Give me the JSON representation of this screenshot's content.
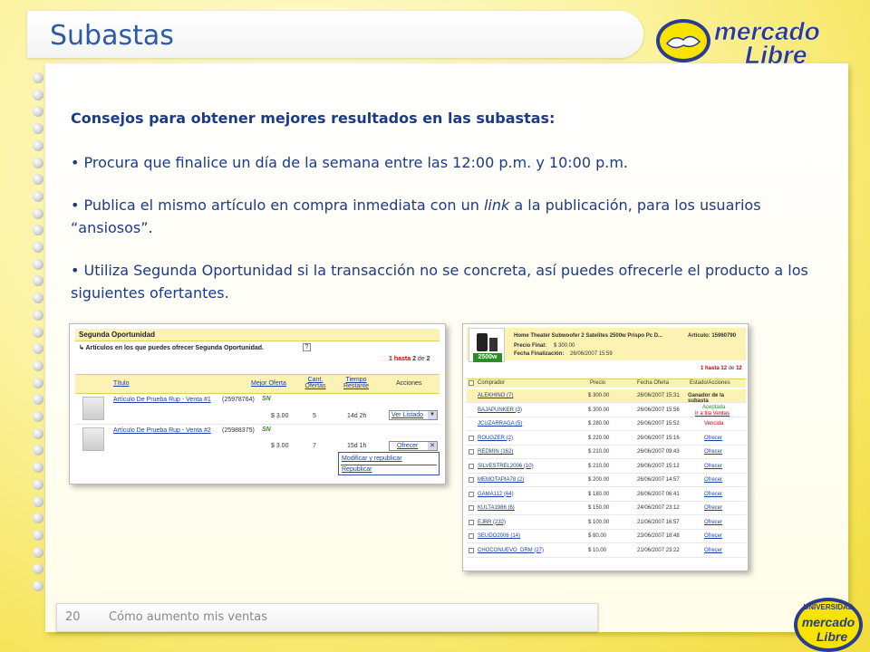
{
  "slide": {
    "title": "Subastas",
    "heading": "Consejos para obtener mejores resultados en las subastas:",
    "bullet1": "• Procura que finalice un día de la semana entre las 12:00 p.m. y 10:00 p.m.",
    "bullet2_pre": "• Publica el mismo artículo en compra inmediata con un ",
    "bullet2_link": "link",
    "bullet2_post": " a la publicación, para los usuarios “ansiosos”.",
    "bullet3": "• Utiliza Segunda Oportunidad si la transacción no se concreta, así puedes ofrecerle el producto a los siguientes ofertantes.",
    "page_number": "20",
    "footer_text": "Cómo aumento mis ventas"
  },
  "logo": {
    "word1": "mercado",
    "word2": "Libre",
    "colors": {
      "blue": "#2a3c8f",
      "yellow": "#f7e200"
    }
  },
  "badge": {
    "top_text": "UNIVERSIDAD",
    "word1": "mercado",
    "word2": "Libre"
  },
  "screenshot1": {
    "title": "Segunda Oportunidad",
    "subtitle": "↳ Artículos en los que puedes ofrecer Segunda Oportunidad.",
    "help": "?",
    "pagination": {
      "prefix": "1 hasta ",
      "current": "2",
      "of": " de ",
      "total": "2"
    },
    "columns": [
      "Título",
      "Mejor Oferta",
      "Cant. Ofertas",
      "Tiempo Restante",
      "Acciones"
    ],
    "rows": [
      {
        "title": "Artículo De Prueba Rup - Venta #1",
        "id": "(25978764)",
        "tag": "SN",
        "price": "$ 3.00",
        "offers": "5",
        "time": "14d 2h",
        "action": "Ver Listado"
      },
      {
        "title": "Artículo De Prueba Rup - Venta #2",
        "id": "(25988375)",
        "tag": "SN",
        "price": "$ 3.00",
        "offers": "7",
        "time": "15d 1h",
        "action": "Ofrecer"
      }
    ],
    "menu": [
      "Modificar y republicar",
      "Republicar"
    ]
  },
  "screenshot2": {
    "product_title": "Home Theater Subwoofer 2 Satelites 2500w Prispo Pc D...",
    "article_label": "Artículo: 15960790",
    "final_price_label": "Precio Final:",
    "final_price": "$ 300.00",
    "end_date_label": "Fecha Finalización:",
    "end_date": "26/06/2007 15:59",
    "product_badge": "2500w",
    "pagination": {
      "prefix": "1 hasta ",
      "current": "12",
      "of": " de ",
      "total": "12"
    },
    "columns": [
      "Comprador",
      "Precio",
      "Fecha Oferta",
      "Estado/Acciones"
    ],
    "rows": [
      {
        "buyer": "ALEKHINO (7)",
        "price": "$ 300.00",
        "date": "26/06/2007 15:31",
        "status": "Ganador de la subasta"
      },
      {
        "buyer": "BAJAPUNKER (3)",
        "price": "$ 300.00",
        "date": "26/06/2007 15:56",
        "status": "Aceptada",
        "status2": "Ir a tila Ventas"
      },
      {
        "buyer": "JCUZARRAGA (5)",
        "price": "$ 280.00",
        "date": "26/06/2007 15:52",
        "status": "Vencida"
      },
      {
        "buyer": "ROUGZER (2)",
        "price": "$ 220.00",
        "date": "26/06/2007 15:16",
        "status": "Ofrecer"
      },
      {
        "buyer": "REDMIN (162)",
        "price": "$ 210.00",
        "date": "26/06/2007 09:43",
        "status": "Ofrecer"
      },
      {
        "buyer": "SILVESTREL2006 (10)",
        "price": "$ 210.00",
        "date": "26/06/2007 15:12",
        "status": "Ofrecer"
      },
      {
        "buyer": "MEMOTAPIA78 (2)",
        "price": "$ 200.00",
        "date": "26/06/2007 14:57",
        "status": "Ofrecer"
      },
      {
        "buyer": "GAMA112 (64)",
        "price": "$ 180.00",
        "date": "26/06/2007 06:41",
        "status": "Ofrecer"
      },
      {
        "buyer": "KULTA1986 (6)",
        "price": "$ 150.00",
        "date": "24/06/2007 23:12",
        "status": "Ofrecer"
      },
      {
        "buyer": "EJBR (232)",
        "price": "$ 100.00",
        "date": "21/06/2007 16:57",
        "status": "Ofrecer"
      },
      {
        "buyer": "SEUDO2006 (14)",
        "price": "$ 80.00",
        "date": "23/06/2007 18:48",
        "status": "Ofrecer"
      },
      {
        "buyer": "CHOCONUEVO_DRM (27)",
        "price": "$ 10.00",
        "date": "21/06/2007 23:22",
        "status": "Ofrecer"
      }
    ]
  }
}
